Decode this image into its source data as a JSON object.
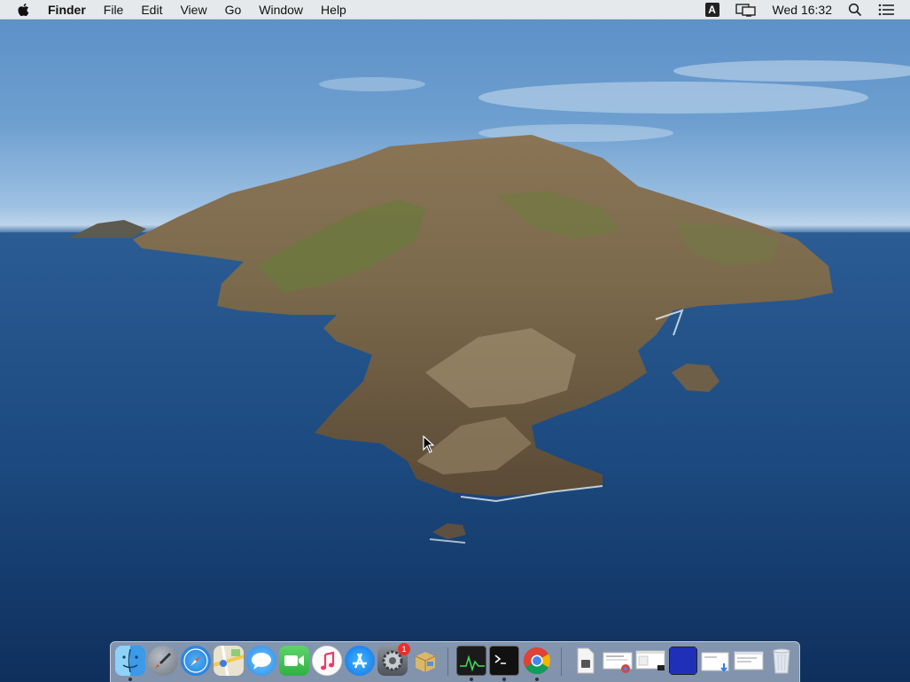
{
  "menubar": {
    "app_name": "Finder",
    "menus": [
      "File",
      "Edit",
      "View",
      "Go",
      "Window",
      "Help"
    ],
    "input_source": "A",
    "clock": "Wed 16:32"
  },
  "dock": {
    "apps": [
      {
        "name": "Finder",
        "icon": "finder-icon",
        "running": true
      },
      {
        "name": "Launchpad",
        "icon": "rocket-icon",
        "running": false
      },
      {
        "name": "Safari",
        "icon": "compass-icon",
        "running": false
      },
      {
        "name": "Maps",
        "icon": "map-icon",
        "running": false
      },
      {
        "name": "Messages",
        "icon": "messages-icon",
        "running": false
      },
      {
        "name": "FaceTime",
        "icon": "video-camera-icon",
        "running": false
      },
      {
        "name": "Music",
        "icon": "music-note-icon",
        "running": false
      },
      {
        "name": "App Store",
        "icon": "app-store-icon",
        "running": false
      },
      {
        "name": "System Preferences",
        "icon": "gear-icon",
        "running": false,
        "badge": "1"
      },
      {
        "name": "Archive Utility",
        "icon": "box-icon",
        "running": false
      }
    ],
    "running_apps": [
      {
        "name": "Activity Monitor",
        "icon": "activity-monitor-icon",
        "running": true
      },
      {
        "name": "Terminal",
        "icon": "terminal-icon",
        "running": true
      },
      {
        "name": "Chrome",
        "icon": "chrome-icon",
        "running": true
      }
    ],
    "documents": [
      {
        "name": "Document",
        "icon": "document-icon"
      },
      {
        "name": "Chrome window",
        "icon": "window-thumbnail-icon"
      },
      {
        "name": "Window",
        "icon": "window-thumbnail-icon"
      },
      {
        "name": "Blue window",
        "icon": "window-thumbnail-icon"
      },
      {
        "name": "Downloads window",
        "icon": "window-thumbnail-icon"
      },
      {
        "name": "Window",
        "icon": "window-thumbnail-icon"
      },
      {
        "name": "Trash",
        "icon": "trash-icon"
      }
    ]
  },
  "colors": {
    "menubar_bg": "#ececec",
    "badge": "#e8312c",
    "sea": "#1f4f85",
    "sky": "#6e9fd0"
  }
}
